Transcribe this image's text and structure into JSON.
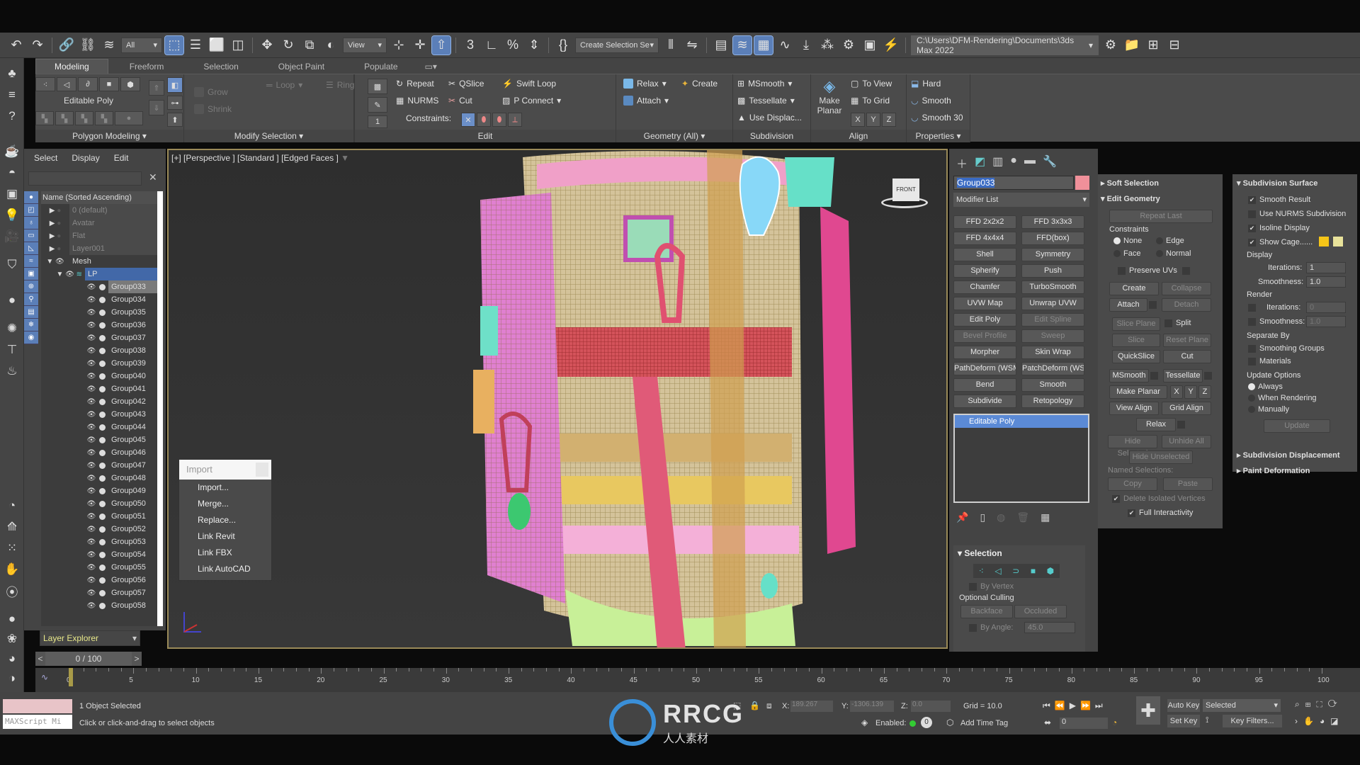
{
  "main_toolbar": {
    "selection_filter": "All",
    "reference_coord": "View",
    "named_selection": "Create Selection Se",
    "project_path": "C:\\Users\\DFM-Rendering\\Documents\\3ds Max 2022"
  },
  "ribbon": {
    "tabs": [
      "Modeling",
      "Freeform",
      "Selection",
      "Object Paint",
      "Populate"
    ],
    "active_tab": "Modeling",
    "groups": {
      "polygon_modeling": {
        "label": "Polygon Modeling",
        "object_type": "Editable Poly"
      },
      "modify_selection": {
        "label": "Modify Selection",
        "grow": "Grow",
        "shrink": "Shrink",
        "loop": "Loop",
        "ring": "Ring"
      },
      "edit": {
        "label": "Edit",
        "repeat": "Repeat",
        "qslice": "QSlice",
        "swift_loop": "Swift Loop",
        "nurms": "NURMS",
        "cut": "Cut",
        "p_connect": "P Connect",
        "constraints": "Constraints:",
        "spinner_value": "1"
      },
      "geometry": {
        "label": "Geometry (All)",
        "relax": "Relax",
        "create": "Create",
        "attach": "Attach"
      },
      "subdivision": {
        "label": "Subdivision",
        "msmooth": "MSmooth",
        "tessellate": "Tessellate",
        "use_displac": "Use Displac..."
      },
      "align": {
        "label": "Align",
        "make_planar": "Make Planar",
        "to_view": "To View",
        "to_grid": "To Grid",
        "x": "X",
        "y": "Y",
        "z": "Z"
      },
      "properties": {
        "label": "Properties",
        "hard": "Hard",
        "smooth": "Smooth",
        "smooth30": "Smooth 30"
      }
    }
  },
  "scene_explorer": {
    "menu": [
      "Select",
      "Display",
      "Edit"
    ],
    "column_header": "Name (Sorted Ascending)",
    "layers": [
      "0 (default)",
      "Avatar",
      "Flat",
      "Layer001"
    ],
    "open_layer": "Mesh",
    "sub_layer": "LP",
    "objects": [
      "Group033",
      "Group034",
      "Group035",
      "Group036",
      "Group037",
      "Group038",
      "Group039",
      "Group040",
      "Group041",
      "Group042",
      "Group043",
      "Group044",
      "Group045",
      "Group046",
      "Group047",
      "Group048",
      "Group049",
      "Group050",
      "Group051",
      "Group052",
      "Group053",
      "Group054",
      "Group055",
      "Group056",
      "Group057",
      "Group058"
    ],
    "selected_object": "Group033",
    "explorer_type": "Layer Explorer"
  },
  "viewport": {
    "label": "[+] [Perspective ] [Standard ] [Edged Faces ]",
    "viewcube_face": "FRONT"
  },
  "import_menu": {
    "title": "Import",
    "items": [
      "Import...",
      "Merge...",
      "Replace...",
      "Link Revit",
      "Link FBX",
      "Link AutoCAD"
    ]
  },
  "command_panel": {
    "object_name": "Group033",
    "object_color": "#f0909a",
    "modifier_list": "Modifier List",
    "modifier_buttons": [
      "FFD 2x2x2",
      "FFD 3x3x3",
      "FFD 4x4x4",
      "FFD(box)",
      "Shell",
      "Symmetry",
      "Spherify",
      "Push",
      "Chamfer",
      "TurboSmooth",
      "UVW Map",
      "Unwrap UVW",
      "Edit Poly",
      "Edit Spline",
      "Bevel Profile",
      "Sweep",
      "Morpher",
      "Skin Wrap",
      "PathDeform (WSM)",
      "PatchDeform (WSM)",
      "Bend",
      "Smooth",
      "Subdivide",
      "Retopology"
    ],
    "disabled_modifiers": [
      "Edit Spline",
      "Bevel Profile",
      "Sweep"
    ],
    "stack_item": "Editable Poly",
    "selection_rollout": {
      "title": "Selection",
      "by_vertex": "By Vertex",
      "optional_culling": "Optional Culling",
      "backface": "Backface",
      "occluded": "Occluded",
      "by_angle": "By Angle:",
      "angle_value": "45.0"
    }
  },
  "edit_geometry": {
    "soft_selection": "Soft Selection",
    "title": "Edit Geometry",
    "repeat_last": "Repeat Last",
    "constraints": "Constraints",
    "constraint_options": [
      "None",
      "Edge",
      "Face",
      "Normal"
    ],
    "constraint_selected": "None",
    "preserve_uvs": "Preserve UVs",
    "create": "Create",
    "collapse": "Collapse",
    "attach": "Attach",
    "detach": "Detach",
    "slice_plane": "Slice Plane",
    "split": "Split",
    "slice": "Slice",
    "reset_plane": "Reset Plane",
    "quickslice": "QuickSlice",
    "cut": "Cut",
    "msmooth": "MSmooth",
    "tessellate": "Tessellate",
    "make_planar": "Make Planar",
    "x": "X",
    "y": "Y",
    "z": "Z",
    "view_align": "View Align",
    "grid_align": "Grid Align",
    "relax": "Relax",
    "hide_selected": "Hide Selected",
    "unhide_all": "Unhide All",
    "hide_unselected": "Hide Unselected",
    "named_selections": "Named Selections:",
    "copy": "Copy",
    "paste": "Paste",
    "delete_isolated": "Delete Isolated Vertices",
    "full_interactivity": "Full Interactivity"
  },
  "subdivision_surface": {
    "title": "Subdivision Surface",
    "smooth_result": "Smooth Result",
    "use_nurms": "Use NURMS Subdivision",
    "isoline_display": "Isoline Display",
    "show_cage": "Show Cage......",
    "cage_colors": [
      "#f5c518",
      "#e8e29a"
    ],
    "display": "Display",
    "iterations_label": "Iterations:",
    "smoothness_label": "Smoothness:",
    "display_iterations": "1",
    "display_smoothness": "1.0",
    "render": "Render",
    "render_iterations": "0",
    "render_smoothness": "1.0",
    "separate_by": "Separate By",
    "smoothing_groups": "Smoothing Groups",
    "materials": "Materials",
    "update_options": "Update Options",
    "always": "Always",
    "when_rendering": "When Rendering",
    "manually": "Manually",
    "update": "Update",
    "subdivision_displacement": "Subdivision Displacement",
    "paint_deformation": "Paint Deformation"
  },
  "timeline": {
    "frame_display": "0 / 100",
    "ticks": [
      "0",
      "5",
      "10",
      "15",
      "20",
      "25",
      "30",
      "35",
      "40",
      "45",
      "50",
      "55",
      "60",
      "65",
      "70",
      "75",
      "80",
      "85",
      "90",
      "95",
      "100"
    ]
  },
  "status_bar": {
    "maxscript": "MAXScript Mi",
    "selection_status": "1 Object Selected",
    "prompt": "Click or click-and-drag to select objects",
    "x_label": "X:",
    "x_value": "189.267",
    "y_label": "Y:",
    "y_value": "-1306.139",
    "z_label": "Z:",
    "z_value": "0.0",
    "grid": "Grid = 10.0",
    "enabled": "Enabled:",
    "add_time_tag": "Add Time Tag",
    "current_frame": "0",
    "auto_key": "Auto Key",
    "set_key": "Set Key",
    "key_mode": "Selected",
    "key_filters": "Key Filters..."
  },
  "watermark": {
    "text": "RRCG",
    "subtext": "人人素材"
  }
}
